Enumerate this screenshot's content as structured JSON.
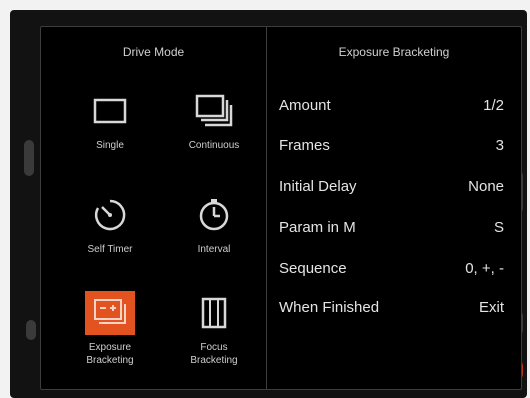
{
  "drive_mode": {
    "title": "Drive Mode",
    "modes": [
      {
        "label_line1": "Single",
        "label_line2": "",
        "icon": "single-frame-icon",
        "selected": false
      },
      {
        "label_line1": "Continuous",
        "label_line2": "",
        "icon": "continuous-icon",
        "selected": false
      },
      {
        "label_line1": "Self Timer",
        "label_line2": "",
        "icon": "self-timer-icon",
        "selected": false
      },
      {
        "label_line1": "Interval",
        "label_line2": "",
        "icon": "interval-icon",
        "selected": false
      },
      {
        "label_line1": "Exposure",
        "label_line2": "Bracketing",
        "icon": "exposure-bracketing-icon",
        "selected": true
      },
      {
        "label_line1": "Focus",
        "label_line2": "Bracketing",
        "icon": "focus-bracketing-icon",
        "selected": false
      }
    ]
  },
  "exposure_bracketing": {
    "title": "Exposure Bracketing",
    "settings": [
      {
        "name": "Amount",
        "value": "1/2"
      },
      {
        "name": "Frames",
        "value": "3"
      },
      {
        "name": "Initial Delay",
        "value": "None"
      },
      {
        "name": "Param in M",
        "value": "S"
      },
      {
        "name": "Sequence",
        "value": "0, +, -"
      },
      {
        "name": "When Finished",
        "value": "Exit"
      }
    ]
  },
  "colors": {
    "accent": "#e2531f",
    "panel_bg": "#000000",
    "text": "#e4e4e4"
  }
}
